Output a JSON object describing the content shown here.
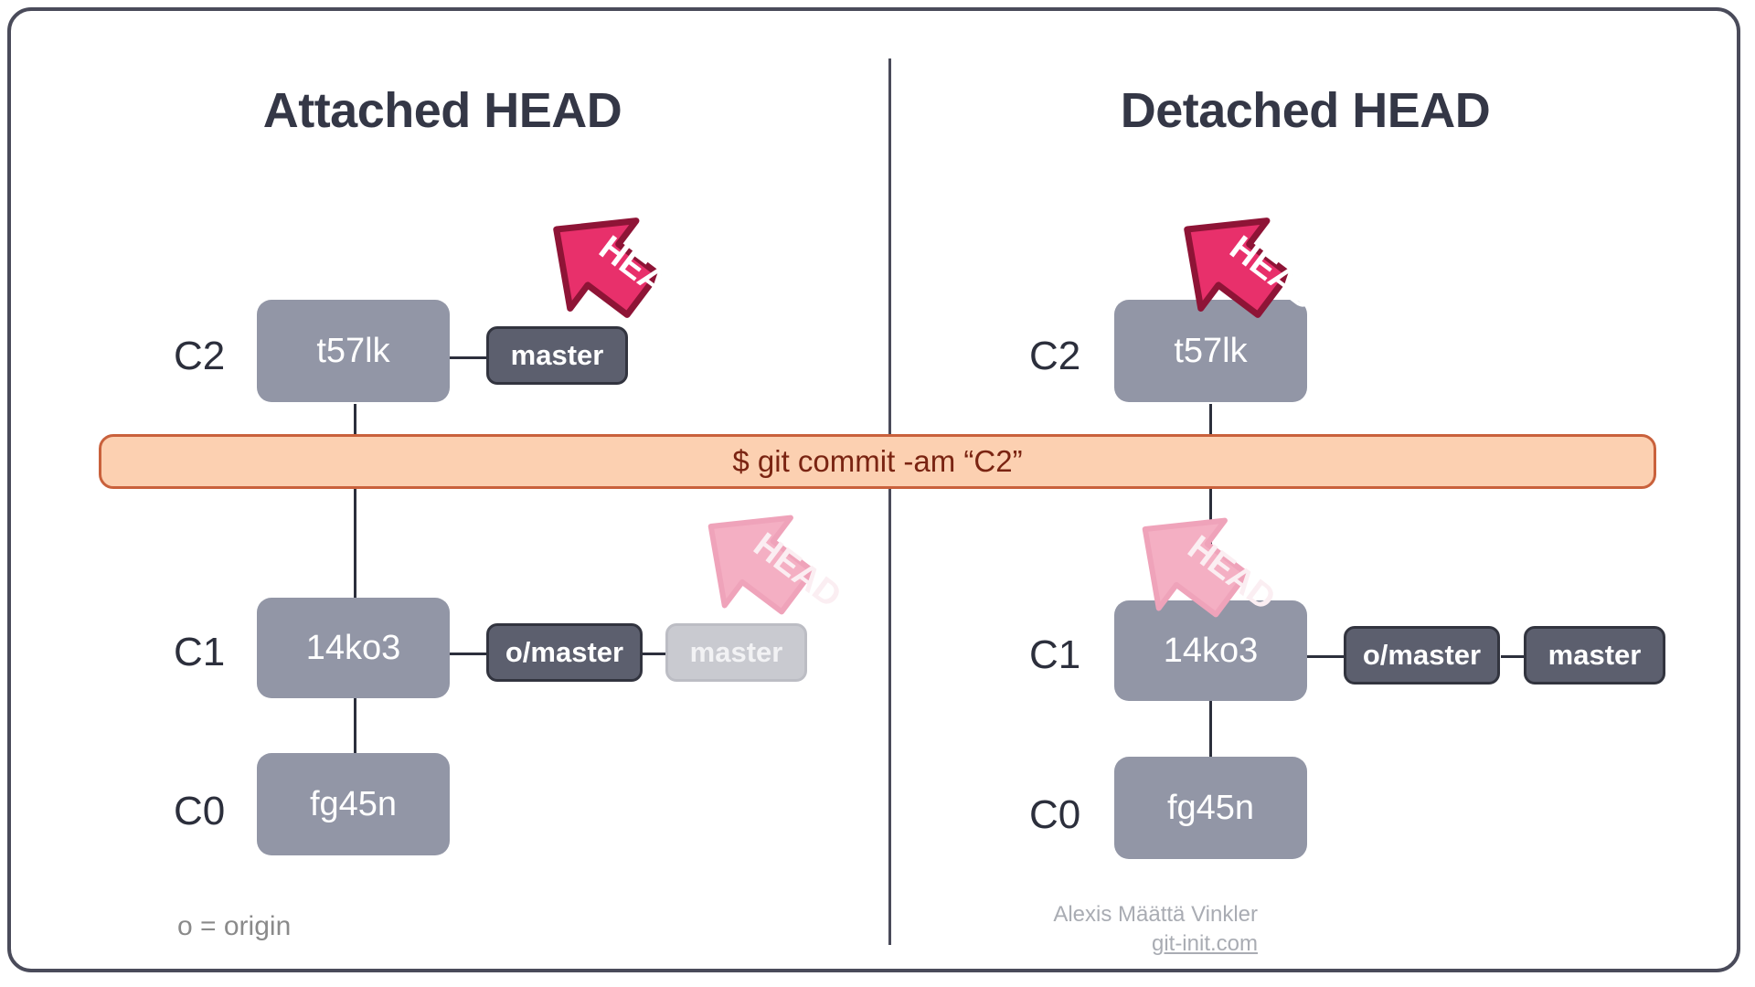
{
  "card": {
    "border_color": "#4a4b5a",
    "background": "#ffffff"
  },
  "panels": [
    {
      "id": "attached",
      "title": "Attached HEAD",
      "rows": [
        {
          "label": "C2",
          "commit": "t57lk"
        },
        {
          "label": "C1",
          "commit": "14ko3"
        },
        {
          "label": "C0",
          "commit": "fg45n"
        }
      ],
      "refs": {
        "c2_master": "master",
        "c1_origin_master": "o/master",
        "c1_master": "master"
      },
      "head_top": "HEAD",
      "head_bottom": "HEAD"
    },
    {
      "id": "detached",
      "title": "Detached HEAD",
      "rows": [
        {
          "label": "C2",
          "commit": "t57lk"
        },
        {
          "label": "C1",
          "commit": "14ko3"
        },
        {
          "label": "C0",
          "commit": "fg45n"
        }
      ],
      "refs": {
        "c1_origin_master": "o/master",
        "c1_master": "master"
      },
      "head_top": "HEAD",
      "head_bottom": "HEAD"
    }
  ],
  "command_banner": {
    "text": "$ git commit -am “C2”",
    "background": "#fcd0b1",
    "border_color": "#c9613c",
    "text_color": "#7a2412"
  },
  "legend": "o = origin",
  "credit": {
    "author": "Alexis Määttä Vinkler",
    "site": "git-init.com"
  },
  "colors": {
    "commit_box": "#9296a6",
    "ref_box": "#5c5f6e",
    "ref_box_border": "#32343f",
    "ref_box_faded": "#c9cad0",
    "head_arrow": "#e8306b",
    "head_arrow_stroke": "#8e1436",
    "head_arrow_faded": "#f4afc3",
    "title": "#343746",
    "edge": "#2c2f3c"
  }
}
